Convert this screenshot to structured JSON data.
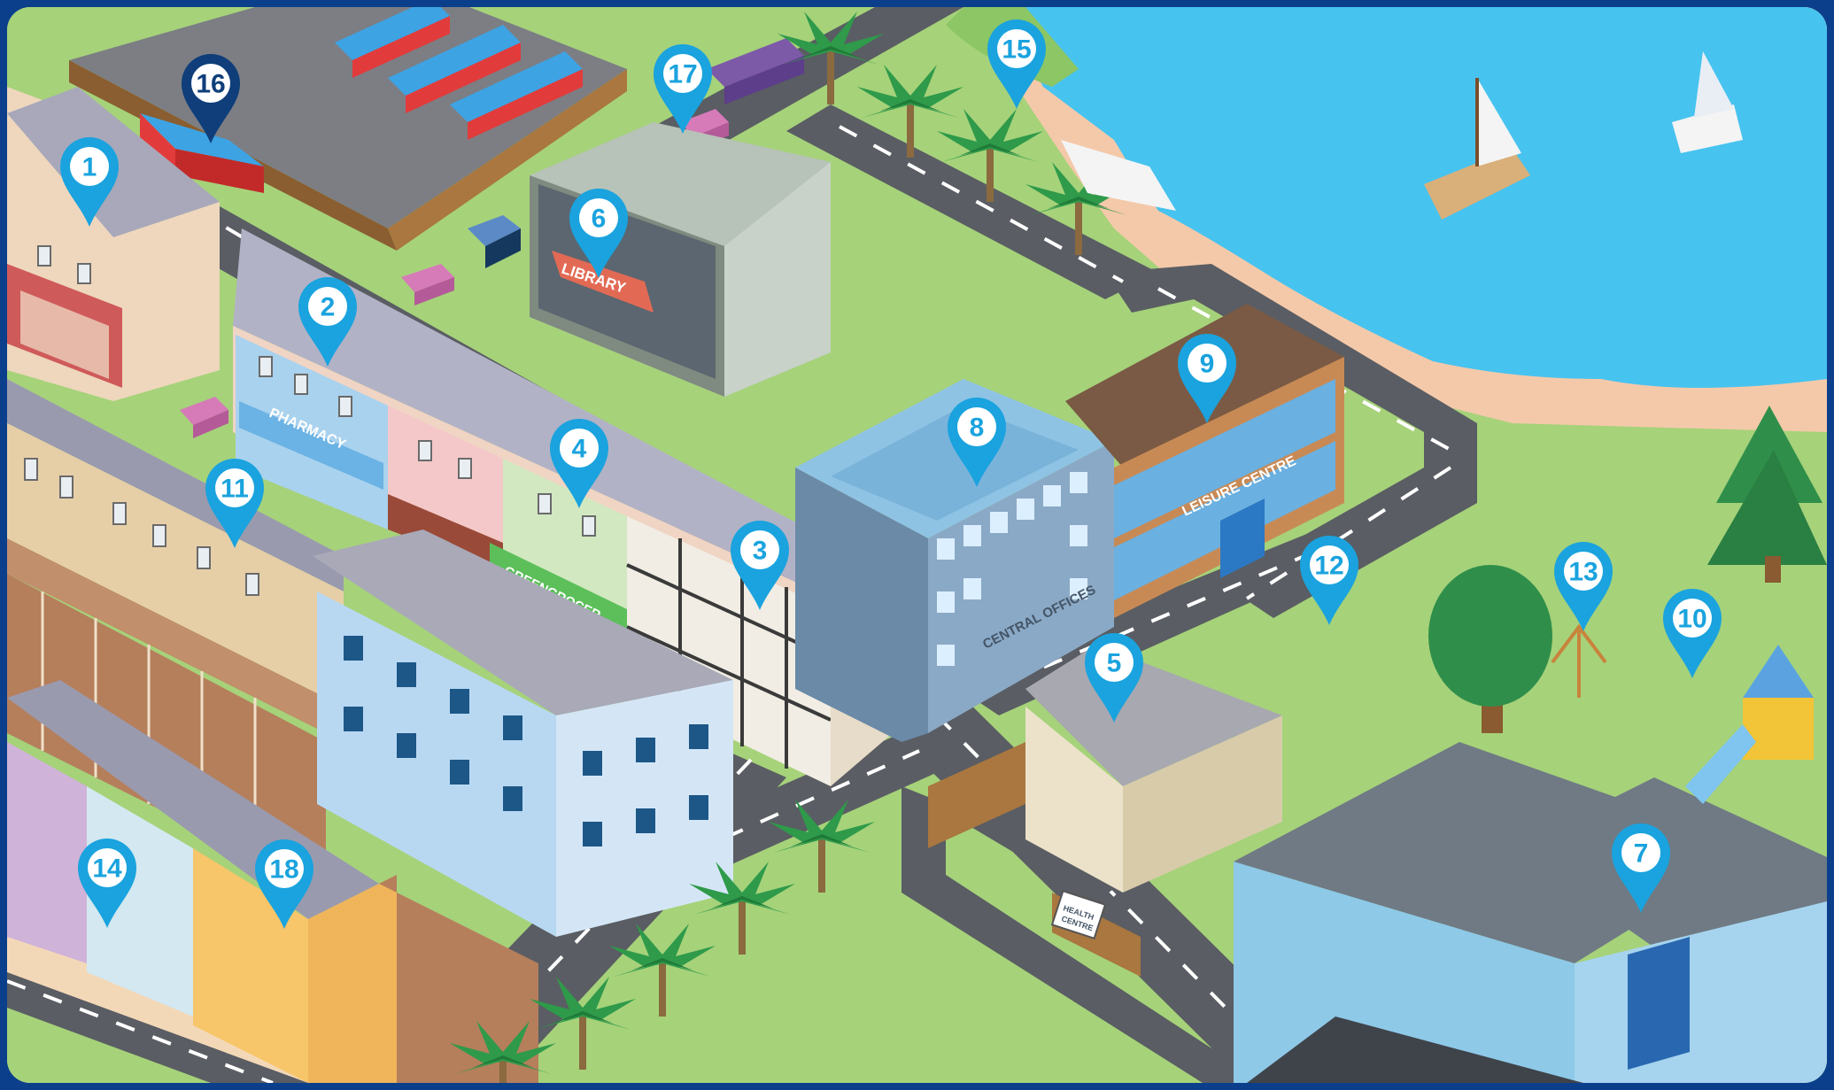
{
  "colors": {
    "frame": "#0b3f8c",
    "grass": "#a6d27a",
    "water": "#47c3ef",
    "sand": "#f4c9aa",
    "road": "#5a5d63",
    "pin": "#1aa3de",
    "pin_highlight": "#0f3e7a"
  },
  "signs": {
    "library": "LIBRARY",
    "pharmacy": "PHARMACY",
    "greengrocer": "GREENGROCER",
    "central_offices": "CENTRAL OFFICES",
    "leisure_centre": "LEISURE CENTRE",
    "health_centre_line1": "HEALTH",
    "health_centre_line2": "CENTRE"
  },
  "markers": [
    {
      "id": "1",
      "label": "1",
      "icon": "location-pin-icon"
    },
    {
      "id": "2",
      "label": "2",
      "icon": "location-pin-icon"
    },
    {
      "id": "3",
      "label": "3",
      "icon": "location-pin-icon"
    },
    {
      "id": "4",
      "label": "4",
      "icon": "location-pin-icon"
    },
    {
      "id": "5",
      "label": "5",
      "icon": "location-pin-icon"
    },
    {
      "id": "6",
      "label": "6",
      "icon": "location-pin-icon"
    },
    {
      "id": "7",
      "label": "7",
      "icon": "location-pin-icon"
    },
    {
      "id": "8",
      "label": "8",
      "icon": "location-pin-icon"
    },
    {
      "id": "9",
      "label": "9",
      "icon": "location-pin-icon"
    },
    {
      "id": "10",
      "label": "10",
      "icon": "location-pin-icon"
    },
    {
      "id": "11",
      "label": "11",
      "icon": "location-pin-icon"
    },
    {
      "id": "12",
      "label": "12",
      "icon": "location-pin-icon"
    },
    {
      "id": "13",
      "label": "13",
      "icon": "location-pin-icon"
    },
    {
      "id": "14",
      "label": "14",
      "icon": "location-pin-icon"
    },
    {
      "id": "15",
      "label": "15",
      "icon": "location-pin-icon"
    },
    {
      "id": "16",
      "label": "16",
      "icon": "location-pin-icon",
      "highlighted": true
    },
    {
      "id": "17",
      "label": "17",
      "icon": "location-pin-icon"
    },
    {
      "id": "18",
      "label": "18",
      "icon": "location-pin-icon"
    }
  ]
}
